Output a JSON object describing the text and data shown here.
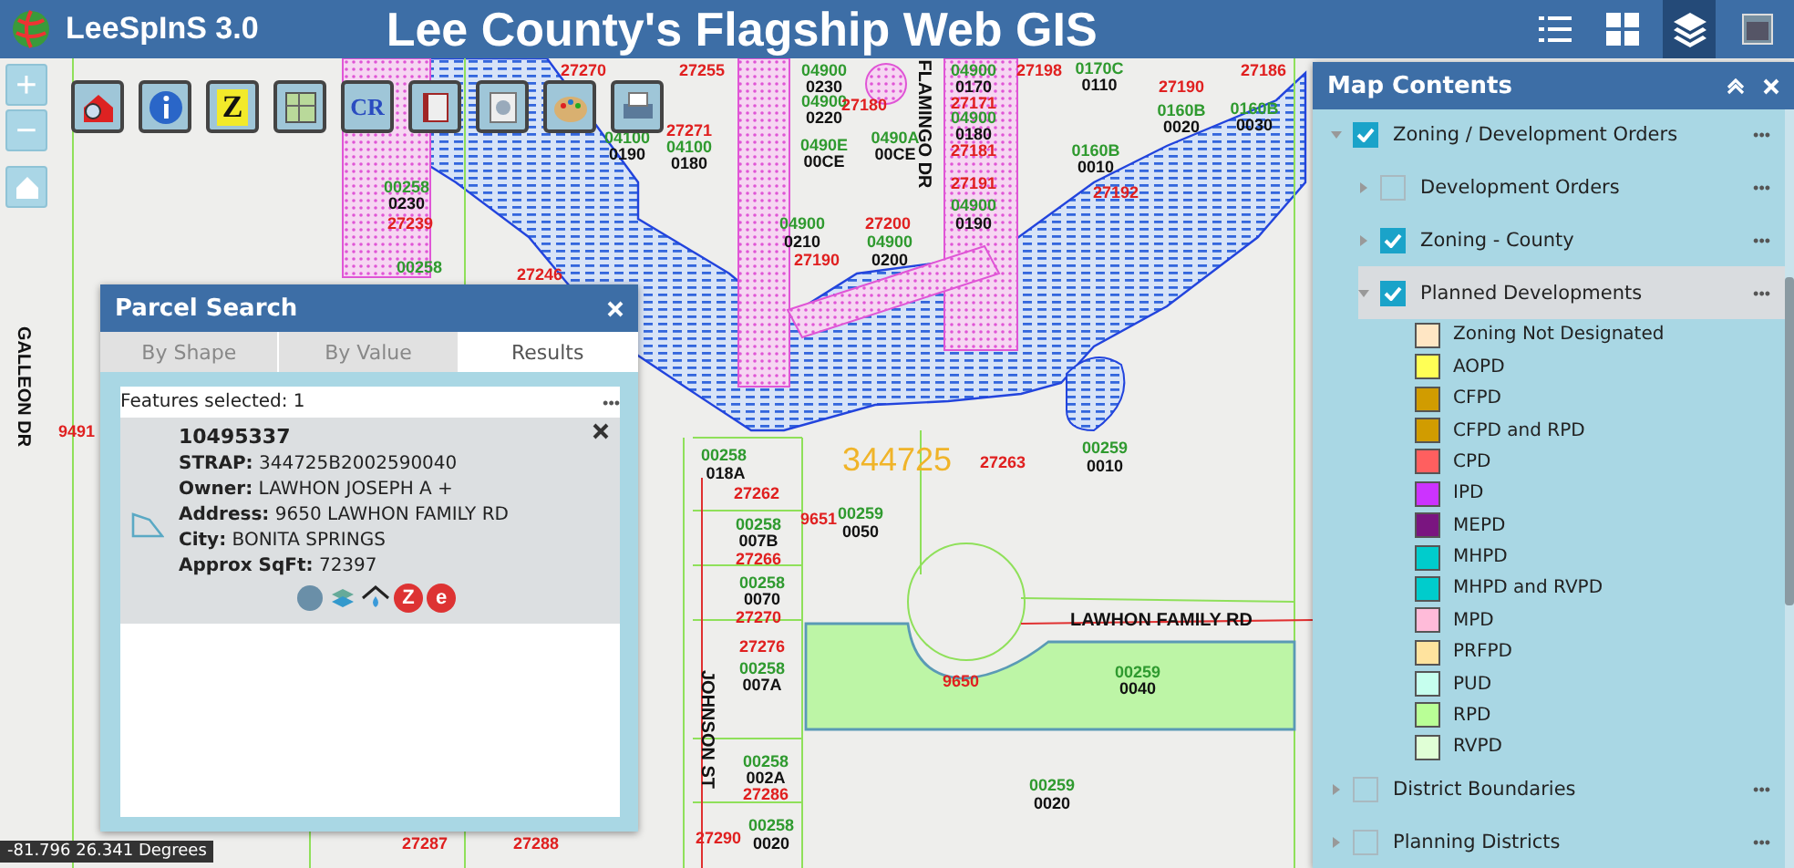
{
  "header": {
    "app_name": "LeeSpInS 3.0",
    "title": "Lee County's Flagship Web GIS",
    "tools": [
      {
        "kind": "list",
        "selected": false
      },
      {
        "kind": "grid",
        "selected": false
      },
      {
        "kind": "layers",
        "selected": true
      },
      {
        "kind": "window",
        "selected": false
      }
    ]
  },
  "toolbar": [
    {
      "kind": "house"
    },
    {
      "kind": "info"
    },
    {
      "kind": "letter",
      "glyph": "Z"
    },
    {
      "kind": "map"
    },
    {
      "kind": "letter",
      "glyph": "CR"
    },
    {
      "kind": "book"
    },
    {
      "kind": "disc"
    },
    {
      "kind": "palette"
    },
    {
      "kind": "printer"
    }
  ],
  "zoom_controls": {
    "zoom_in": "+",
    "zoom_out": "−"
  },
  "map": {
    "labels": [
      {
        "text": "27270",
        "kind": "address"
      },
      {
        "text": "27255",
        "kind": "address"
      },
      {
        "text": "04900",
        "kind": "block"
      },
      {
        "text": "0230",
        "kind": "lot"
      },
      {
        "text": "04900",
        "kind": "block"
      },
      {
        "text": "0220",
        "kind": "lot"
      },
      {
        "text": "27180",
        "kind": "address"
      },
      {
        "text": "04900",
        "kind": "block"
      },
      {
        "text": "0170",
        "kind": "lot"
      },
      {
        "text": "27171",
        "kind": "address"
      },
      {
        "text": "04900",
        "kind": "block"
      },
      {
        "text": "0180",
        "kind": "lot"
      },
      {
        "text": "27181",
        "kind": "address"
      },
      {
        "text": "27191",
        "kind": "address"
      },
      {
        "text": "27198",
        "kind": "address"
      },
      {
        "text": "0170C",
        "kind": "block"
      },
      {
        "text": "0110",
        "kind": "lot"
      },
      {
        "text": "27186",
        "kind": "address"
      },
      {
        "text": "27190",
        "kind": "address"
      },
      {
        "text": "0160B",
        "kind": "block"
      },
      {
        "text": "0020",
        "kind": "lot"
      },
      {
        "text": "0160B",
        "kind": "block"
      },
      {
        "text": "0030",
        "kind": "lot"
      },
      {
        "text": "0160B",
        "kind": "block"
      },
      {
        "text": "0010",
        "kind": "lot"
      },
      {
        "text": "27192",
        "kind": "address"
      },
      {
        "text": "0490E",
        "kind": "block"
      },
      {
        "text": "00CE",
        "kind": "lot"
      },
      {
        "text": "0490A",
        "kind": "block"
      },
      {
        "text": "00CE",
        "kind": "lot"
      },
      {
        "text": "FLAMINGO DR",
        "kind": "road-vertical"
      },
      {
        "text": "27271",
        "kind": "address"
      },
      {
        "text": "04100",
        "kind": "block"
      },
      {
        "text": "0190",
        "kind": "lot"
      },
      {
        "text": "04100",
        "kind": "block"
      },
      {
        "text": "0180",
        "kind": "lot"
      },
      {
        "text": "00258",
        "kind": "block"
      },
      {
        "text": "0230",
        "kind": "lot"
      },
      {
        "text": "27239",
        "kind": "address"
      },
      {
        "text": "00258",
        "kind": "block"
      },
      {
        "text": "27246",
        "kind": "address"
      },
      {
        "text": "04900",
        "kind": "block"
      },
      {
        "text": "0210",
        "kind": "lot"
      },
      {
        "text": "27190",
        "kind": "address"
      },
      {
        "text": "27200",
        "kind": "address"
      },
      {
        "text": "04900",
        "kind": "block"
      },
      {
        "text": "0200",
        "kind": "lot"
      },
      {
        "text": "04900",
        "kind": "block"
      },
      {
        "text": "0190",
        "kind": "lot"
      },
      {
        "text": "344725",
        "kind": "section"
      },
      {
        "text": "27263",
        "kind": "address"
      },
      {
        "text": "00259",
        "kind": "block"
      },
      {
        "text": "0010",
        "kind": "lot"
      },
      {
        "text": "00258",
        "kind": "block"
      },
      {
        "text": "018A",
        "kind": "lot"
      },
      {
        "text": "27262",
        "kind": "address"
      },
      {
        "text": "9651",
        "kind": "address"
      },
      {
        "text": "00259",
        "kind": "block"
      },
      {
        "text": "0050",
        "kind": "lot"
      },
      {
        "text": "00258",
        "kind": "block"
      },
      {
        "text": "007B",
        "kind": "lot"
      },
      {
        "text": "27266",
        "kind": "address"
      },
      {
        "text": "00258",
        "kind": "block"
      },
      {
        "text": "0070",
        "kind": "lot"
      },
      {
        "text": "27270",
        "kind": "address"
      },
      {
        "text": "27276",
        "kind": "address"
      },
      {
        "text": "00258",
        "kind": "block"
      },
      {
        "text": "007A",
        "kind": "lot"
      },
      {
        "text": "LAWHON FAMILY RD",
        "kind": "road"
      },
      {
        "text": "9650",
        "kind": "address"
      },
      {
        "text": "00259",
        "kind": "block"
      },
      {
        "text": "0040",
        "kind": "lot"
      },
      {
        "text": "JOHNSON ST",
        "kind": "road-vertical"
      },
      {
        "text": "00258",
        "kind": "block"
      },
      {
        "text": "002A",
        "kind": "lot"
      },
      {
        "text": "27286",
        "kind": "address"
      },
      {
        "text": "00259",
        "kind": "block"
      },
      {
        "text": "0020",
        "kind": "lot"
      },
      {
        "text": "27287",
        "kind": "address"
      },
      {
        "text": "27288",
        "kind": "address"
      },
      {
        "text": "27290",
        "kind": "address"
      },
      {
        "text": "00258",
        "kind": "block"
      },
      {
        "text": "0020",
        "kind": "lot"
      },
      {
        "text": "GALLEON DR",
        "kind": "road-vertical"
      },
      {
        "text": "9491",
        "kind": "address"
      }
    ]
  },
  "coordinates": "-81.796 26.341 Degrees",
  "parcel_search": {
    "title": "Parcel Search",
    "tabs": [
      {
        "label": "By Shape",
        "selected": false
      },
      {
        "label": "By Value",
        "selected": false
      },
      {
        "label": "Results",
        "selected": true
      }
    ],
    "summary": "Features selected: 1",
    "menu": "•••",
    "result": {
      "id": "10495337",
      "fields": [
        {
          "label": "STRAP:",
          "value": "344725B2002590040"
        },
        {
          "label": "Owner:",
          "value": "LAWHON JOSEPH A +"
        },
        {
          "label": "Address:",
          "value": "9650 LAWHON FAMILY RD"
        },
        {
          "label": "City:",
          "value": "BONITA SPRINGS"
        },
        {
          "label": "Approx SqFt:",
          "value": "72397"
        }
      ],
      "links": [
        {
          "kind": "globe"
        },
        {
          "kind": "layers"
        },
        {
          "kind": "house"
        },
        {
          "kind": "badge",
          "glyph": "Z"
        },
        {
          "kind": "badge",
          "glyph": "e"
        }
      ]
    }
  },
  "map_contents": {
    "title": "Map Contents",
    "layers": [
      {
        "label": "Zoning / Development Orders",
        "checked": true,
        "expanded": true,
        "selected": false,
        "menu": "•••",
        "children": [
          {
            "label": "Development Orders",
            "checked": false,
            "expanded": false,
            "selected": false,
            "menu": "•••"
          },
          {
            "label": "Zoning - County",
            "checked": true,
            "expanded": false,
            "selected": false,
            "menu": "•••"
          },
          {
            "label": "Planned Developments",
            "checked": true,
            "expanded": true,
            "selected": true,
            "menu": "•••",
            "legend": [
              {
                "label": "Zoning Not Designated",
                "color": "#ffe6c4"
              },
              {
                "label": "AOPD",
                "color": "#ffff55"
              },
              {
                "label": "CFPD",
                "color": "#d19c00"
              },
              {
                "label": "CFPD and RPD",
                "color": "#d19c00"
              },
              {
                "label": "CPD",
                "color": "#ff5f5f"
              },
              {
                "label": "IPD",
                "color": "#cc33ff"
              },
              {
                "label": "MEPD",
                "color": "#7a1580"
              },
              {
                "label": "MHPD",
                "color": "#00cccc"
              },
              {
                "label": "MHPD and RVPD",
                "color": "#00cccc"
              },
              {
                "label": "MPD",
                "color": "#ffbbd9"
              },
              {
                "label": "PRFPD",
                "color": "#ffe39e"
              },
              {
                "label": "PUD",
                "color": "#c6ffee"
              },
              {
                "label": "RPD",
                "color": "#b9ff96"
              },
              {
                "label": "RVPD",
                "color": "#e0ffd6"
              }
            ]
          }
        ]
      },
      {
        "label": "District Boundaries",
        "checked": false,
        "expanded": false,
        "selected": false,
        "menu": "•••"
      },
      {
        "label": "Planning Districts",
        "checked": false,
        "expanded": false,
        "selected": false,
        "menu": "•••"
      }
    ]
  }
}
